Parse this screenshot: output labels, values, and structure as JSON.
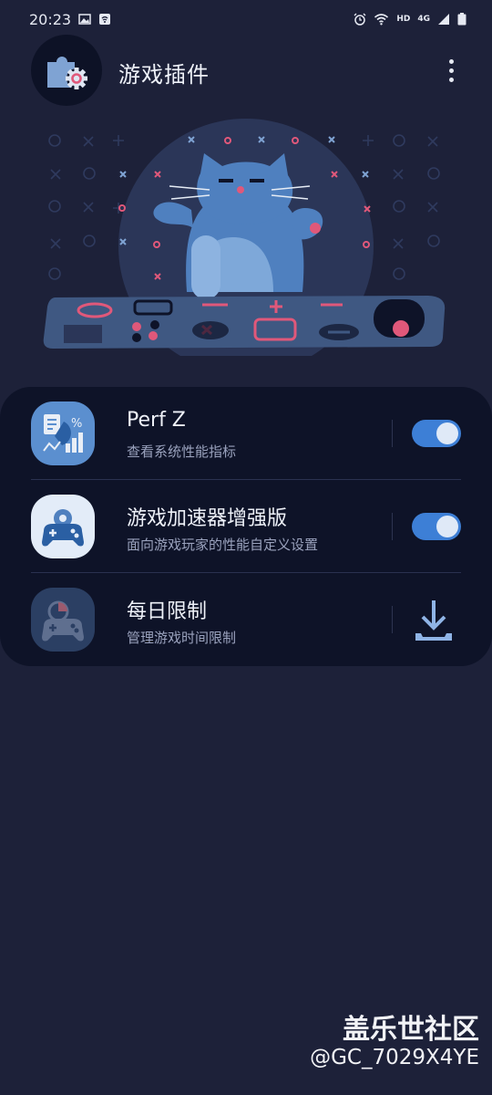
{
  "status_bar": {
    "time": "20:23",
    "network": "HD",
    "signal": "4G"
  },
  "header": {
    "title": "游戏插件"
  },
  "plugins": [
    {
      "title": "Perf Z",
      "subtitle": "查看系统性能指标",
      "enabled": true
    },
    {
      "title": "游戏加速器增强版",
      "subtitle": "面向游戏玩家的性能自定义设置",
      "enabled": true
    },
    {
      "title": "每日限制",
      "subtitle": "管理游戏时间限制",
      "action": "download"
    }
  ],
  "watermark": {
    "brand": "盖乐世社区",
    "user": "@GC_7029X4YE"
  },
  "colors": {
    "background": "#1d2139",
    "card": "#0e1328",
    "toggle_on": "#3d7fd6",
    "accent_pink": "#e0587a"
  }
}
